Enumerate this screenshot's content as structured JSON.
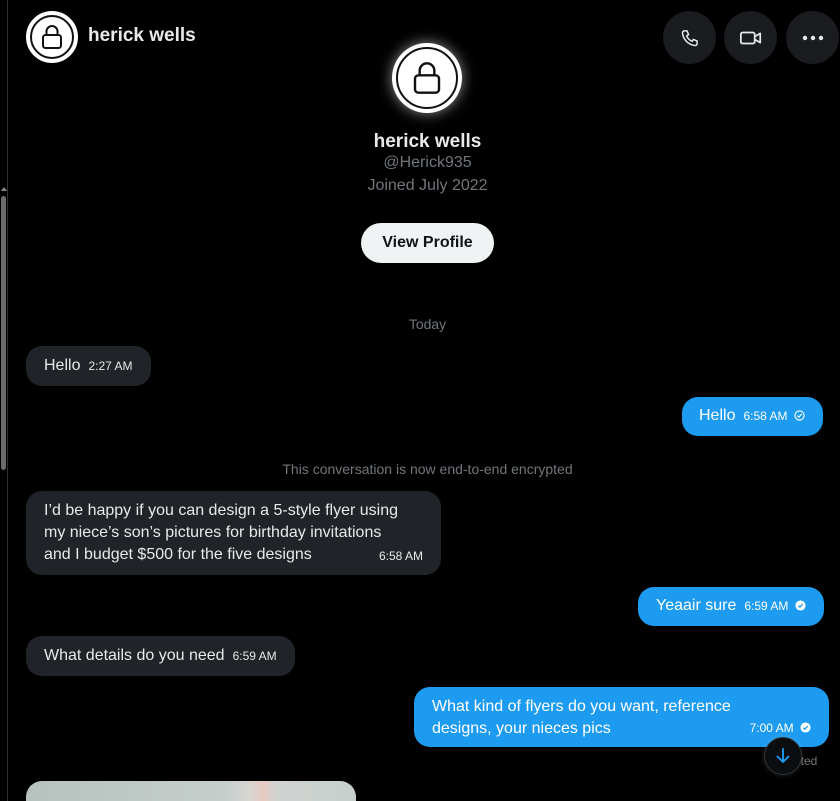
{
  "header": {
    "name": "herick wells",
    "avatar_icon": "lock-icon",
    "buttons": [
      {
        "name": "call-button",
        "icon": "phone-icon"
      },
      {
        "name": "video-call-button",
        "icon": "video-icon"
      },
      {
        "name": "more-options-button",
        "icon": "more-horizontal-icon"
      }
    ]
  },
  "profile": {
    "name": "herick wells",
    "handle": "@Herick935",
    "joined": "Joined July 2022",
    "view_profile_label": "View Profile"
  },
  "conversation": {
    "day_separator": "Today",
    "encryption_notice": "This conversation is now end-to-end encrypted",
    "messages": [
      {
        "direction": "incoming",
        "text": "Hello",
        "time": "2:27 AM"
      },
      {
        "direction": "outgoing",
        "text": "Hello",
        "time": "6:58 AM",
        "status": "sent"
      },
      {
        "direction": "incoming",
        "lines": [
          "I’d be happy if you can design a 5-style flyer using",
          "my niece’s son’s pictures for birthday invitations",
          "and I budget $500 for the five designs"
        ],
        "time": "6:58 AM"
      },
      {
        "direction": "outgoing",
        "text": "Yeaair sure",
        "time": "6:59 AM",
        "status": "read"
      },
      {
        "direction": "incoming",
        "text": "What details do you need",
        "time": "6:59 AM"
      },
      {
        "direction": "outgoing",
        "lines": [
          "What kind of flyers do you want, reference",
          "designs, your nieces pics"
        ],
        "time": "7:00 AM",
        "status": "read"
      }
    ],
    "edited_label": "ited"
  },
  "colors": {
    "background": "#000000",
    "incoming_bubble": "#202327",
    "outgoing_bubble": "#1d9bf0",
    "muted_text": "#71767b",
    "button_bg": "#eff3f4"
  }
}
